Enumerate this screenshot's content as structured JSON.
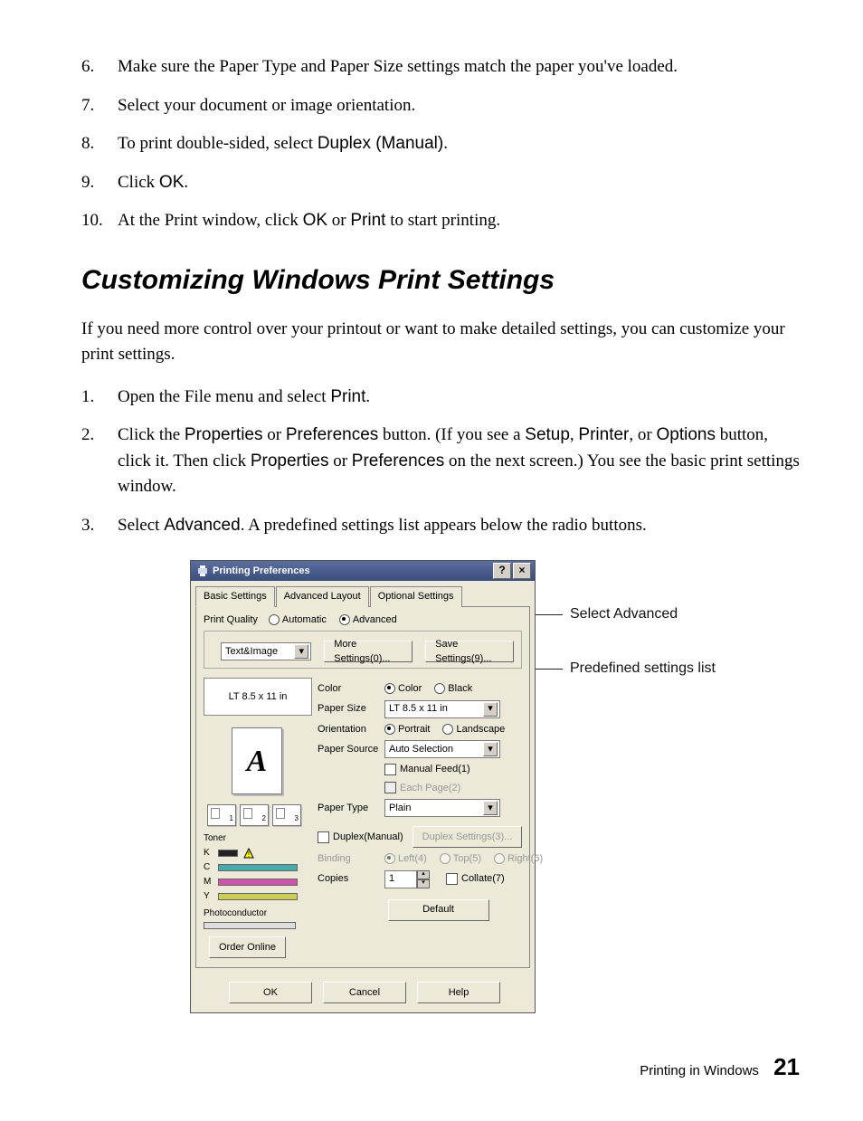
{
  "steps_top": [
    {
      "n": "6.",
      "pre": "Make sure the Paper Type and Paper Size settings match the paper you've loaded."
    },
    {
      "n": "7.",
      "pre": "Select your document or image orientation."
    },
    {
      "n": "8.",
      "a": "To print double-sided, select ",
      "b": "Duplex (Manual)",
      "c": "."
    },
    {
      "n": "9.",
      "a": "Click ",
      "b": "OK",
      "c": "."
    },
    {
      "n": "10.",
      "a": "At the Print window, click ",
      "b": "OK",
      "c": " or ",
      "d": "Print",
      "e": " to start printing."
    }
  ],
  "heading": "Customizing Windows Print Settings",
  "intro": "If you need more control over your printout or want to make detailed settings, you can customize your print settings.",
  "steps_custom": [
    {
      "n": "1.",
      "a": "Open the File menu and select ",
      "b": "Print",
      "c": "."
    },
    {
      "n": "2.",
      "parts": [
        {
          "t": "Click the "
        },
        {
          "s": "Properties"
        },
        {
          "t": " or "
        },
        {
          "s": "Preferences"
        },
        {
          "t": " button. (If you see a "
        },
        {
          "s": "Setup"
        },
        {
          "t": ", "
        },
        {
          "s": "Printer"
        },
        {
          "t": ", or "
        },
        {
          "s": "Options"
        },
        {
          "t": " button, click it. Then click "
        },
        {
          "s": "Properties"
        },
        {
          "t": " or "
        },
        {
          "s": "Preferences"
        },
        {
          "t": " on the next screen.) You see the basic print settings window."
        }
      ]
    },
    {
      "n": "3.",
      "a": "Select ",
      "b": "Advanced",
      "c": ". A predefined settings list appears below the radio buttons."
    }
  ],
  "dialog": {
    "title": "Printing Preferences",
    "tabs": [
      "Basic Settings",
      "Advanced Layout",
      "Optional Settings"
    ],
    "print_quality_label": "Print Quality",
    "pq_auto": "Automatic",
    "pq_adv": "Advanced",
    "preset_value": "Text&Image",
    "more_settings": "More Settings(0)...",
    "save_settings": "Save Settings(9)...",
    "paper_summary": "LT 8.5 x 11 in",
    "preview_letter": "A",
    "toner_label": "Toner",
    "toner": {
      "K": "K",
      "C": "C",
      "M": "M",
      "Y": "Y"
    },
    "photoconductor": "Photoconductor",
    "order_online": "Order Online",
    "fields": {
      "color_label": "Color",
      "color_opt_color": "Color",
      "color_opt_black": "Black",
      "paper_size_label": "Paper Size",
      "paper_size_value": "LT 8.5 x 11 in",
      "orientation_label": "Orientation",
      "orient_portrait": "Portrait",
      "orient_landscape": "Landscape",
      "paper_source_label": "Paper Source",
      "paper_source_value": "Auto Selection",
      "manual_feed": "Manual Feed(1)",
      "each_page": "Each Page(2)",
      "paper_type_label": "Paper Type",
      "paper_type_value": "Plain",
      "duplex_label": "Duplex(Manual)",
      "duplex_settings": "Duplex Settings(3)...",
      "binding_label": "Binding",
      "bind_left": "Left(4)",
      "bind_top": "Top(5)",
      "bind_right": "Right(6)",
      "copies_label": "Copies",
      "copies_value": "1",
      "collate": "Collate(7)",
      "default": "Default"
    },
    "ok": "OK",
    "cancel": "Cancel",
    "help": "Help"
  },
  "callouts": {
    "adv": "Select Advanced",
    "preset": "Predefined settings list"
  },
  "footer": {
    "label": "Printing in Windows",
    "page": "21"
  }
}
